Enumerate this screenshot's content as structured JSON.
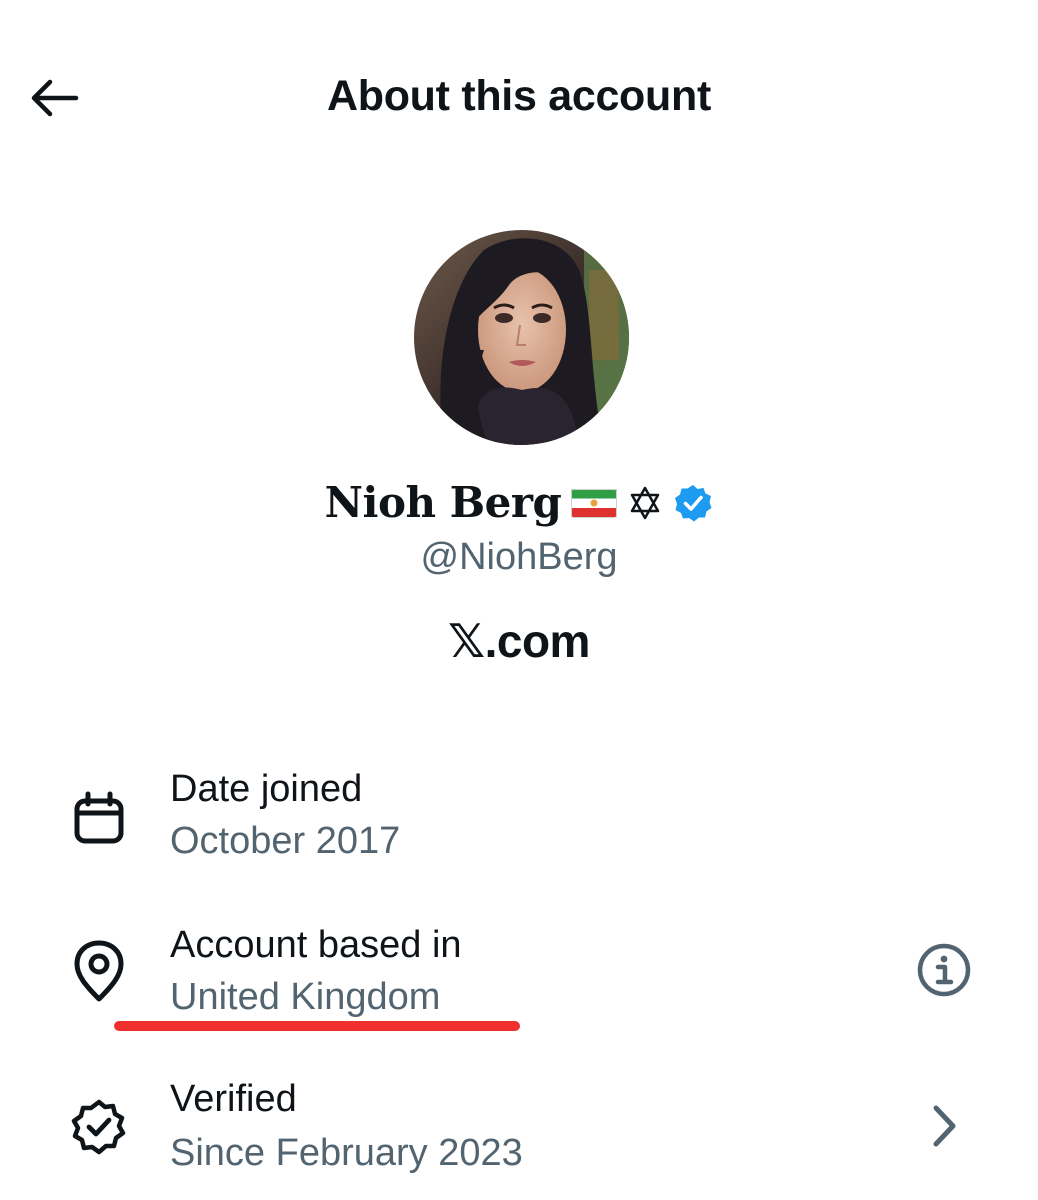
{
  "header": {
    "title": "About this account",
    "back_icon": "arrow-left-icon"
  },
  "profile": {
    "display_name": "Nioh Berg",
    "name_emojis": [
      "flag-of-iran-lion-and-sun",
      "star-of-david"
    ],
    "star_glyph": "✡",
    "verified_badge": "verified-badge-icon",
    "handle": "@NiohBerg",
    "website": "𝕏.com",
    "avatar_alt": "profile-photo"
  },
  "details": [
    {
      "icon": "calendar-icon",
      "label": "Date joined",
      "value": "October 2017"
    },
    {
      "icon": "location-pin-icon",
      "label": "Account based in",
      "value": "United Kingdom",
      "trailing_icon": "info-icon",
      "highlight_color": "#f0302c"
    },
    {
      "icon": "verified-outline-icon",
      "label": "Verified",
      "value": "Since February 2023",
      "trailing_icon": "chevron-right-icon"
    }
  ],
  "colors": {
    "text_primary": "#0f1419",
    "text_secondary": "#536471",
    "verified_blue": "#1d9bf0",
    "annotation_red": "#f0302c"
  }
}
